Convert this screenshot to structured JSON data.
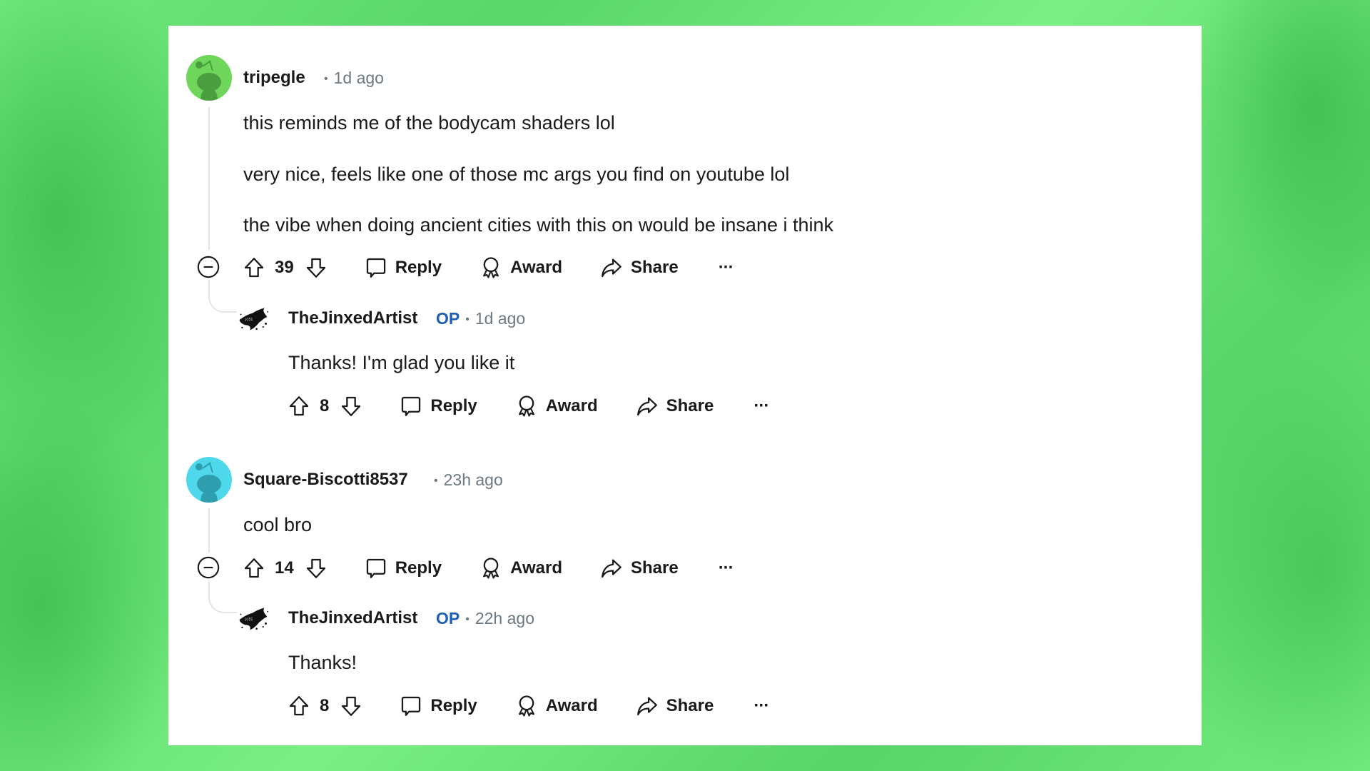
{
  "colors": {
    "background": "#6fe87a",
    "card": "#ffffff",
    "op_badge": "#1f5eb5",
    "meta_text": "#6b7880",
    "thread_line": "#e3e5e8",
    "avatar_green": "#6ed65a",
    "avatar_cyan": "#4fd8ec"
  },
  "comments": [
    {
      "username": "tripegle",
      "time": "1d ago",
      "avatar": "snoo-green-avatar",
      "lines": [
        "this reminds me of the bodycam shaders lol",
        "very nice, feels like one of those mc args you find on youtube lol",
        "the vibe when doing ancient cities with this on would be insane i think"
      ],
      "votes": "39",
      "actions": {
        "reply": "Reply",
        "award": "Award",
        "share": "Share",
        "more": "···"
      },
      "reply": {
        "username": "TheJinxedArtist",
        "badge": "OP",
        "time": "1d ago",
        "avatar": "ink-splatter-avatar",
        "lines": [
          "Thanks! I'm glad you like it"
        ],
        "votes": "8",
        "actions": {
          "reply": "Reply",
          "award": "Award",
          "share": "Share",
          "more": "···"
        }
      }
    },
    {
      "username": "Square-Biscotti8537",
      "time": "23h ago",
      "avatar": "snoo-cyan-avatar",
      "lines": [
        "cool bro"
      ],
      "votes": "14",
      "actions": {
        "reply": "Reply",
        "award": "Award",
        "share": "Share",
        "more": "···"
      },
      "reply": {
        "username": "TheJinxedArtist",
        "badge": "OP",
        "time": "22h ago",
        "avatar": "ink-splatter-avatar",
        "lines": [
          "Thanks!"
        ],
        "votes": "8",
        "actions": {
          "reply": "Reply",
          "award": "Award",
          "share": "Share",
          "more": "···"
        }
      }
    }
  ],
  "meta_separator": "•"
}
